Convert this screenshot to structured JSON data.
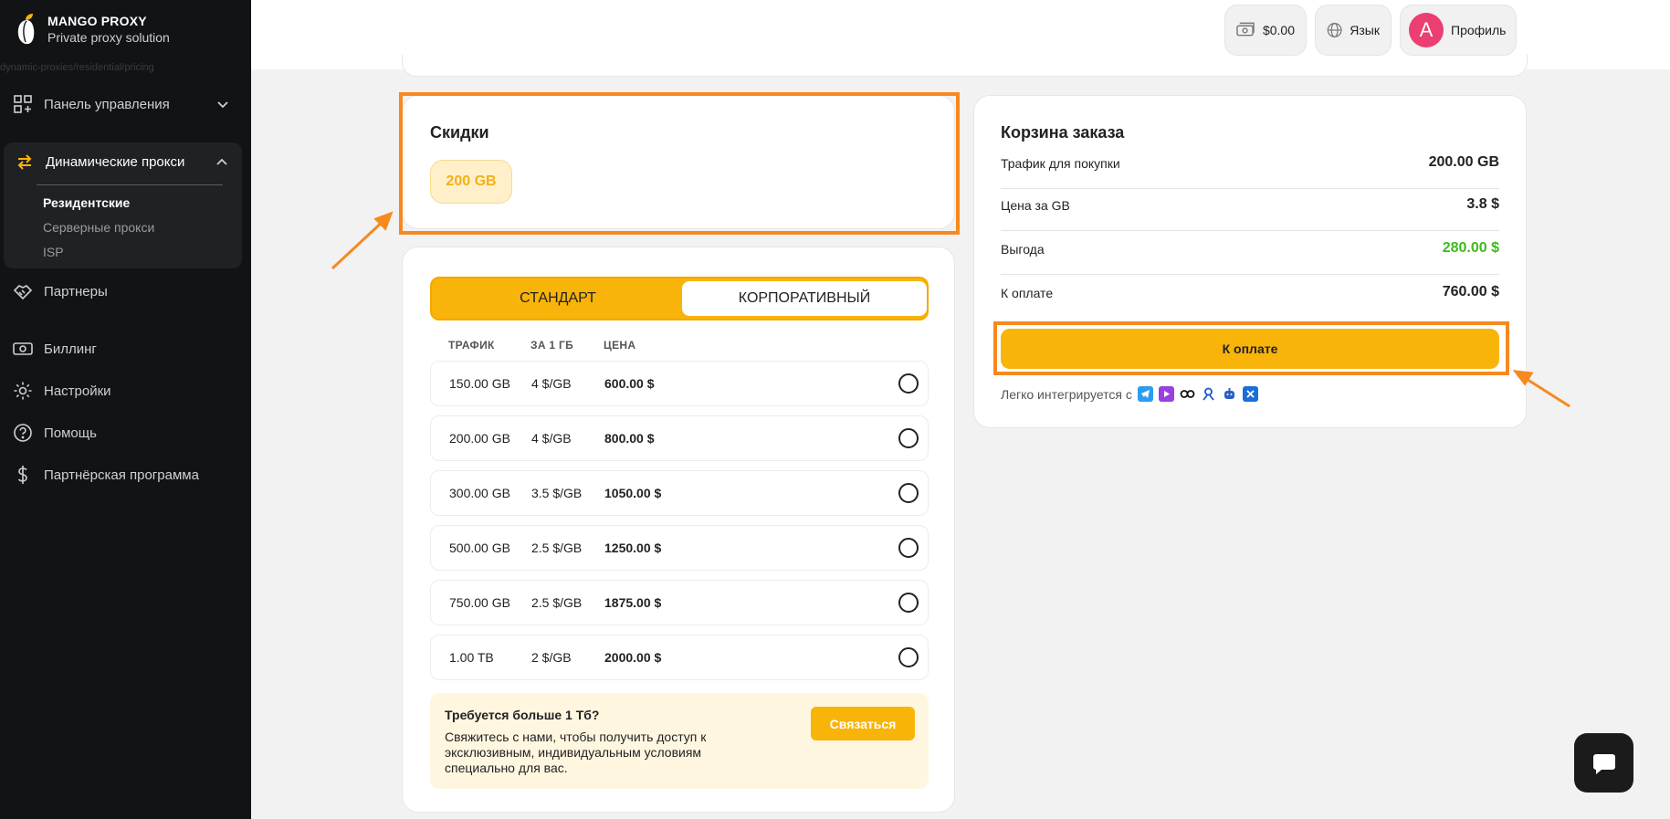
{
  "brand": {
    "title": "MANGO PROXY",
    "subtitle": "Private proxy solution",
    "route": "dynamic-proxies/residential/pricing"
  },
  "sidebar": {
    "items": [
      {
        "label": "Панель управления"
      },
      {
        "label": "Динамические прокси"
      },
      {
        "label": "Партнеры"
      },
      {
        "label": "Биллинг"
      },
      {
        "label": "Настройки"
      },
      {
        "label": "Помощь"
      },
      {
        "label": "Партнёрская программа"
      }
    ],
    "sub": [
      "Резидентские",
      "Серверные прокси",
      "ISP"
    ]
  },
  "header": {
    "balance": "$0.00",
    "language": "Язык",
    "avatar_letter": "A",
    "profile": "Профиль"
  },
  "discounts": {
    "title": "Скидки",
    "chip": "200 GB"
  },
  "plans": {
    "tabs": [
      "СТАНДАРТ",
      "КОРПОРАТИВНЫЙ"
    ],
    "headers": [
      "ТРАФИК",
      "ЗА 1 ГБ",
      "ЦЕНА"
    ],
    "rows": [
      {
        "traffic": "150.00 GB",
        "per": "4 $/GB",
        "price": "600.00 $"
      },
      {
        "traffic": "200.00 GB",
        "per": "4 $/GB",
        "price": "800.00 $"
      },
      {
        "traffic": "300.00 GB",
        "per": "3.5 $/GB",
        "price": "1050.00 $"
      },
      {
        "traffic": "500.00 GB",
        "per": "2.5 $/GB",
        "price": "1250.00 $"
      },
      {
        "traffic": "750.00 GB",
        "per": "2.5 $/GB",
        "price": "1875.00 $"
      },
      {
        "traffic": "1.00 TB",
        "per": "2 $/GB",
        "price": "2000.00 $"
      }
    ],
    "contact": {
      "title": "Требуется больше 1 Тб?",
      "text": "Свяжитесь с нами, чтобы получить доступ к эксклюзивным, индивидуальным условиям специально для вас.",
      "button": "Связаться"
    }
  },
  "cart": {
    "title": "Корзина заказа",
    "rows": [
      {
        "label": "Трафик для покупки",
        "value": "200.00 GB"
      },
      {
        "label": "Цена за GB",
        "value": "3.8 $"
      },
      {
        "label": "Выгода",
        "value": "280.00 $"
      },
      {
        "label": "К оплате",
        "value": "760.00 $"
      }
    ],
    "pay_button": "К оплате",
    "integrates": "Легко интегрируется с"
  },
  "colors": {
    "accent": "#f9b409",
    "highlight": "#f6891f",
    "savings": "#3dbb1b",
    "sidebar": "#111315"
  }
}
